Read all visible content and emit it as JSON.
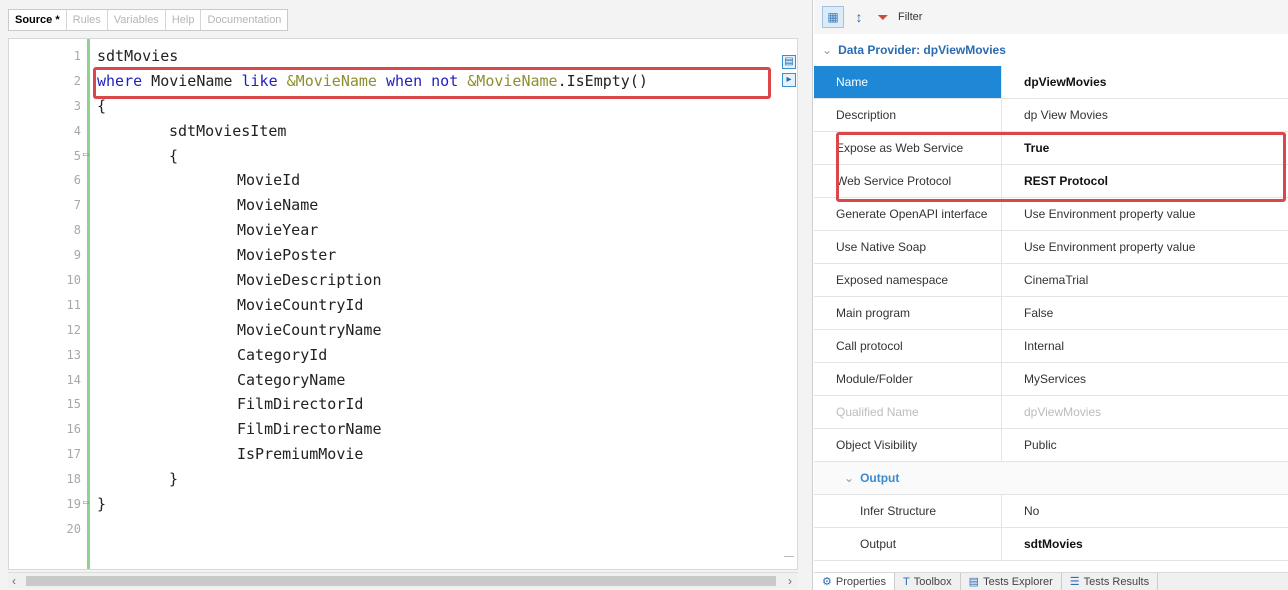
{
  "editor": {
    "tabs": [
      {
        "label": "Source *"
      },
      {
        "label": "Rules"
      },
      {
        "label": "Variables"
      },
      {
        "label": "Help"
      },
      {
        "label": "Documentation"
      }
    ],
    "line_numbers": [
      "1",
      "2",
      "3",
      "4",
      "5",
      "6",
      "7",
      "8",
      "9",
      "10",
      "11",
      "12",
      "13",
      "14",
      "15",
      "16",
      "17",
      "18",
      "19",
      "20"
    ],
    "code": {
      "l1": "sdtMovies",
      "l2_where": "where",
      "l2_field": " MovieName ",
      "l2_like": "like",
      "l2_var1": " &MovieName ",
      "l2_when_not": "when not",
      "l2_var2": " &MovieName",
      "l2_method": ".IsEmpty()",
      "l3": "{",
      "l4": "sdtMoviesItem",
      "l5": "{",
      "fields": [
        "MovieId",
        "MovieName",
        "MovieYear",
        "MoviePoster",
        "MovieDescription",
        "MovieCountryId",
        "MovieCountryName",
        "CategoryId",
        "CategoryName",
        "FilmDirectorId",
        "FilmDirectorName",
        "IsPremiumMovie"
      ],
      "l18": "}",
      "l19": "}"
    }
  },
  "properties": {
    "toolbar": {
      "filter_label": "Filter"
    },
    "section_title": "Data Provider: dpViewMovies",
    "rows": [
      {
        "name": "Name",
        "value": "dpViewMovies"
      },
      {
        "name": "Description",
        "value": "dp View Movies"
      },
      {
        "name": "Expose as Web Service",
        "value": "True"
      },
      {
        "name": "Web Service Protocol",
        "value": "REST Protocol"
      },
      {
        "name": "Generate OpenAPI interface",
        "value": "Use Environment property value"
      },
      {
        "name": "Use Native Soap",
        "value": "Use Environment property value"
      },
      {
        "name": "Exposed namespace",
        "value": "CinemaTrial"
      },
      {
        "name": "Main program",
        "value": "False"
      },
      {
        "name": "Call protocol",
        "value": "Internal"
      },
      {
        "name": "Module/Folder",
        "value": "MyServices"
      },
      {
        "name": "Qualified Name",
        "value": "dpViewMovies"
      },
      {
        "name": "Object Visibility",
        "value": "Public"
      },
      {
        "name": "Output",
        "value": ""
      },
      {
        "name": "Infer Structure",
        "value": "No"
      },
      {
        "name": "Output",
        "value": "sdtMovies"
      }
    ],
    "bottom_tabs": [
      {
        "label": "Properties"
      },
      {
        "label": "Toolbox"
      },
      {
        "label": "Tests Explorer"
      },
      {
        "label": "Tests Results"
      }
    ]
  },
  "colors": {
    "highlight": "#d9474a",
    "selected": "#1e88d6",
    "keyword": "#2020c0",
    "variable": "#8e8e2e"
  }
}
